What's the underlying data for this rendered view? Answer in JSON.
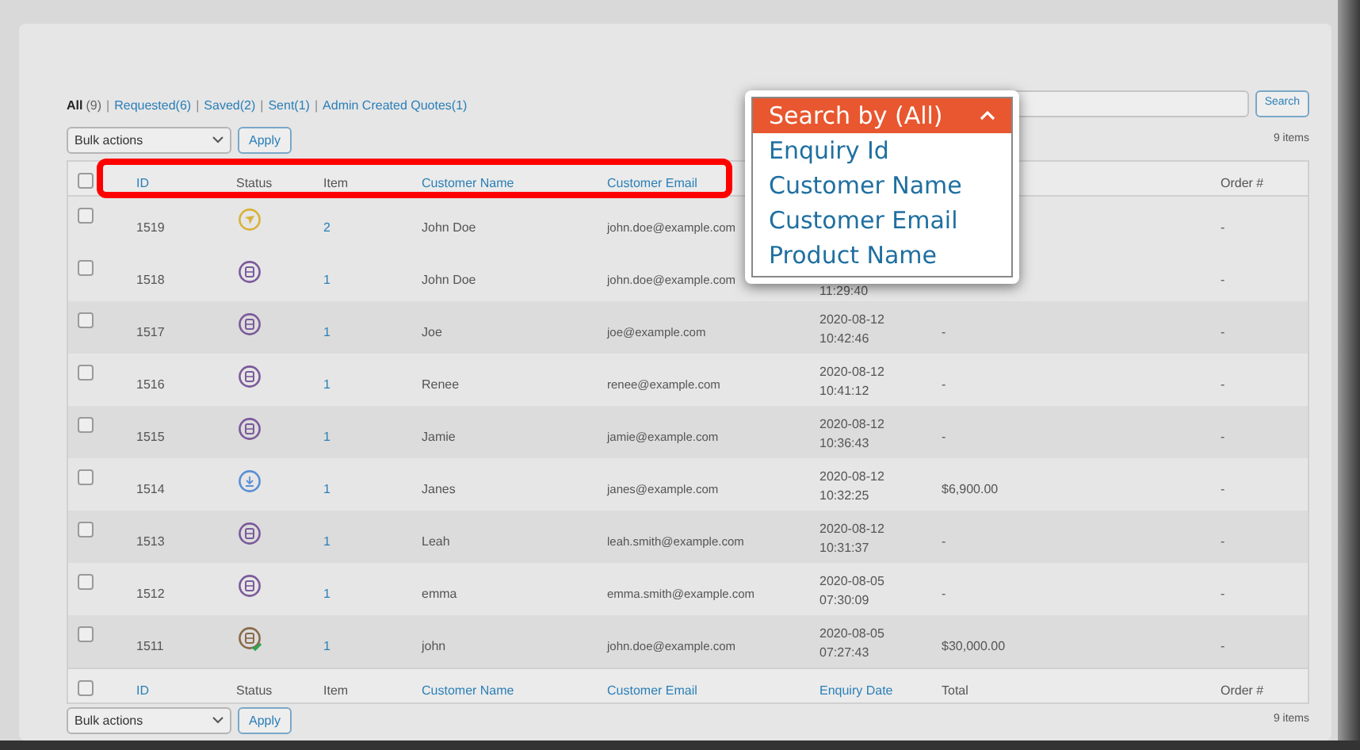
{
  "filters": [
    {
      "label": "All",
      "count": "(9)",
      "selected": true
    },
    {
      "label": "Requested",
      "count": "(6)",
      "selected": false
    },
    {
      "label": "Saved",
      "count": "(2)",
      "selected": false
    },
    {
      "label": "Sent",
      "count": "(1)",
      "selected": false
    },
    {
      "label": "Admin Created Quotes",
      "count": "(1)",
      "selected": false
    }
  ],
  "filter_separator": "|",
  "bulk_actions": {
    "value": "Bulk actions",
    "button": "Apply"
  },
  "search": {
    "button": "Search"
  },
  "item_count": "9 items",
  "header": {
    "checked": false,
    "columns": [
      {
        "label": "ID",
        "sortable": true,
        "kind": "id"
      },
      {
        "label": "Status",
        "sortable": false,
        "kind": "status"
      },
      {
        "label": "Item",
        "sortable": false,
        "kind": "item"
      },
      {
        "label": "Customer Name",
        "sortable": true,
        "kind": "name"
      },
      {
        "label": "Customer Email",
        "sortable": true,
        "kind": "email"
      },
      {
        "label": "Order #",
        "sortable": false,
        "kind": "order"
      }
    ]
  },
  "rows": [
    {
      "id": "1519",
      "kind": "sent",
      "checked": false,
      "item": "2",
      "name": "John Doe",
      "email": "john.doe@example.com",
      "order": "-"
    },
    {
      "id": "1518",
      "kind": "saved",
      "checked": false,
      "item": "1",
      "name": "John Doe",
      "email": "john.doe@example.com",
      "time": "11:29:40",
      "order": "-"
    },
    {
      "id": "1517",
      "kind": "saved",
      "checked": false,
      "item": "1",
      "name": "Joe",
      "email": "joe@example.com",
      "date": "2020-08-12",
      "time": "10:42:46",
      "total": "-",
      "order": "-"
    },
    {
      "id": "1516",
      "kind": "saved",
      "checked": false,
      "item": "1",
      "name": "Renee",
      "email": "renee@example.com",
      "date": "2020-08-12",
      "time": "10:41:12",
      "total": "-",
      "order": "-"
    },
    {
      "id": "1515",
      "kind": "saved",
      "checked": false,
      "item": "1",
      "name": "Jamie",
      "email": "jamie@example.com",
      "date": "2020-08-12",
      "time": "10:36:43",
      "total": "-",
      "order": "-"
    },
    {
      "id": "1514",
      "kind": "requested",
      "checked": false,
      "item": "1",
      "name": "Janes",
      "email": "janes@example.com",
      "date": "2020-08-12",
      "time": "10:32:25",
      "total": "$6,900.00",
      "order": "-"
    },
    {
      "id": "1513",
      "kind": "saved",
      "checked": false,
      "item": "1",
      "name": "Leah",
      "email": "leah.smith@example.com",
      "date": "2020-08-12",
      "time": "10:31:37",
      "total": "-",
      "order": "-"
    },
    {
      "id": "1512",
      "kind": "saved",
      "checked": false,
      "item": "1",
      "name": "emma",
      "email": "emma.smith@example.com",
      "date": "2020-08-05",
      "time": "07:30:09",
      "total": "-",
      "order": "-"
    },
    {
      "id": "1511",
      "kind": "completed",
      "checked": false,
      "item": "1",
      "name": "john",
      "email": "john.doe@example.com",
      "date": "2020-08-05",
      "time": "07:27:43",
      "total": "$30,000.00",
      "order": "-"
    }
  ],
  "footer": {
    "checked": false,
    "columns": [
      {
        "label": "ID",
        "sortable": true,
        "kind": "id"
      },
      {
        "label": "Status",
        "sortable": false,
        "kind": "status"
      },
      {
        "label": "Item",
        "sortable": false,
        "kind": "item"
      },
      {
        "label": "Customer Name",
        "sortable": true,
        "kind": "name"
      },
      {
        "label": "Customer Email",
        "sortable": true,
        "kind": "email"
      },
      {
        "label": "Enquiry Date",
        "sortable": true,
        "kind": "date"
      },
      {
        "label": "Total",
        "sortable": false,
        "kind": "total"
      },
      {
        "label": "Order #",
        "sortable": false,
        "kind": "order"
      }
    ]
  },
  "bottom_bulk_actions": {
    "value": "Bulk actions",
    "button": "Apply"
  },
  "bottom_item_count": "9 items",
  "search_by_menu": {
    "title": "Search by (All)",
    "expanded": true,
    "options": [
      "Enquiry Id",
      "Customer Name",
      "Customer Email",
      "Product Name"
    ]
  }
}
